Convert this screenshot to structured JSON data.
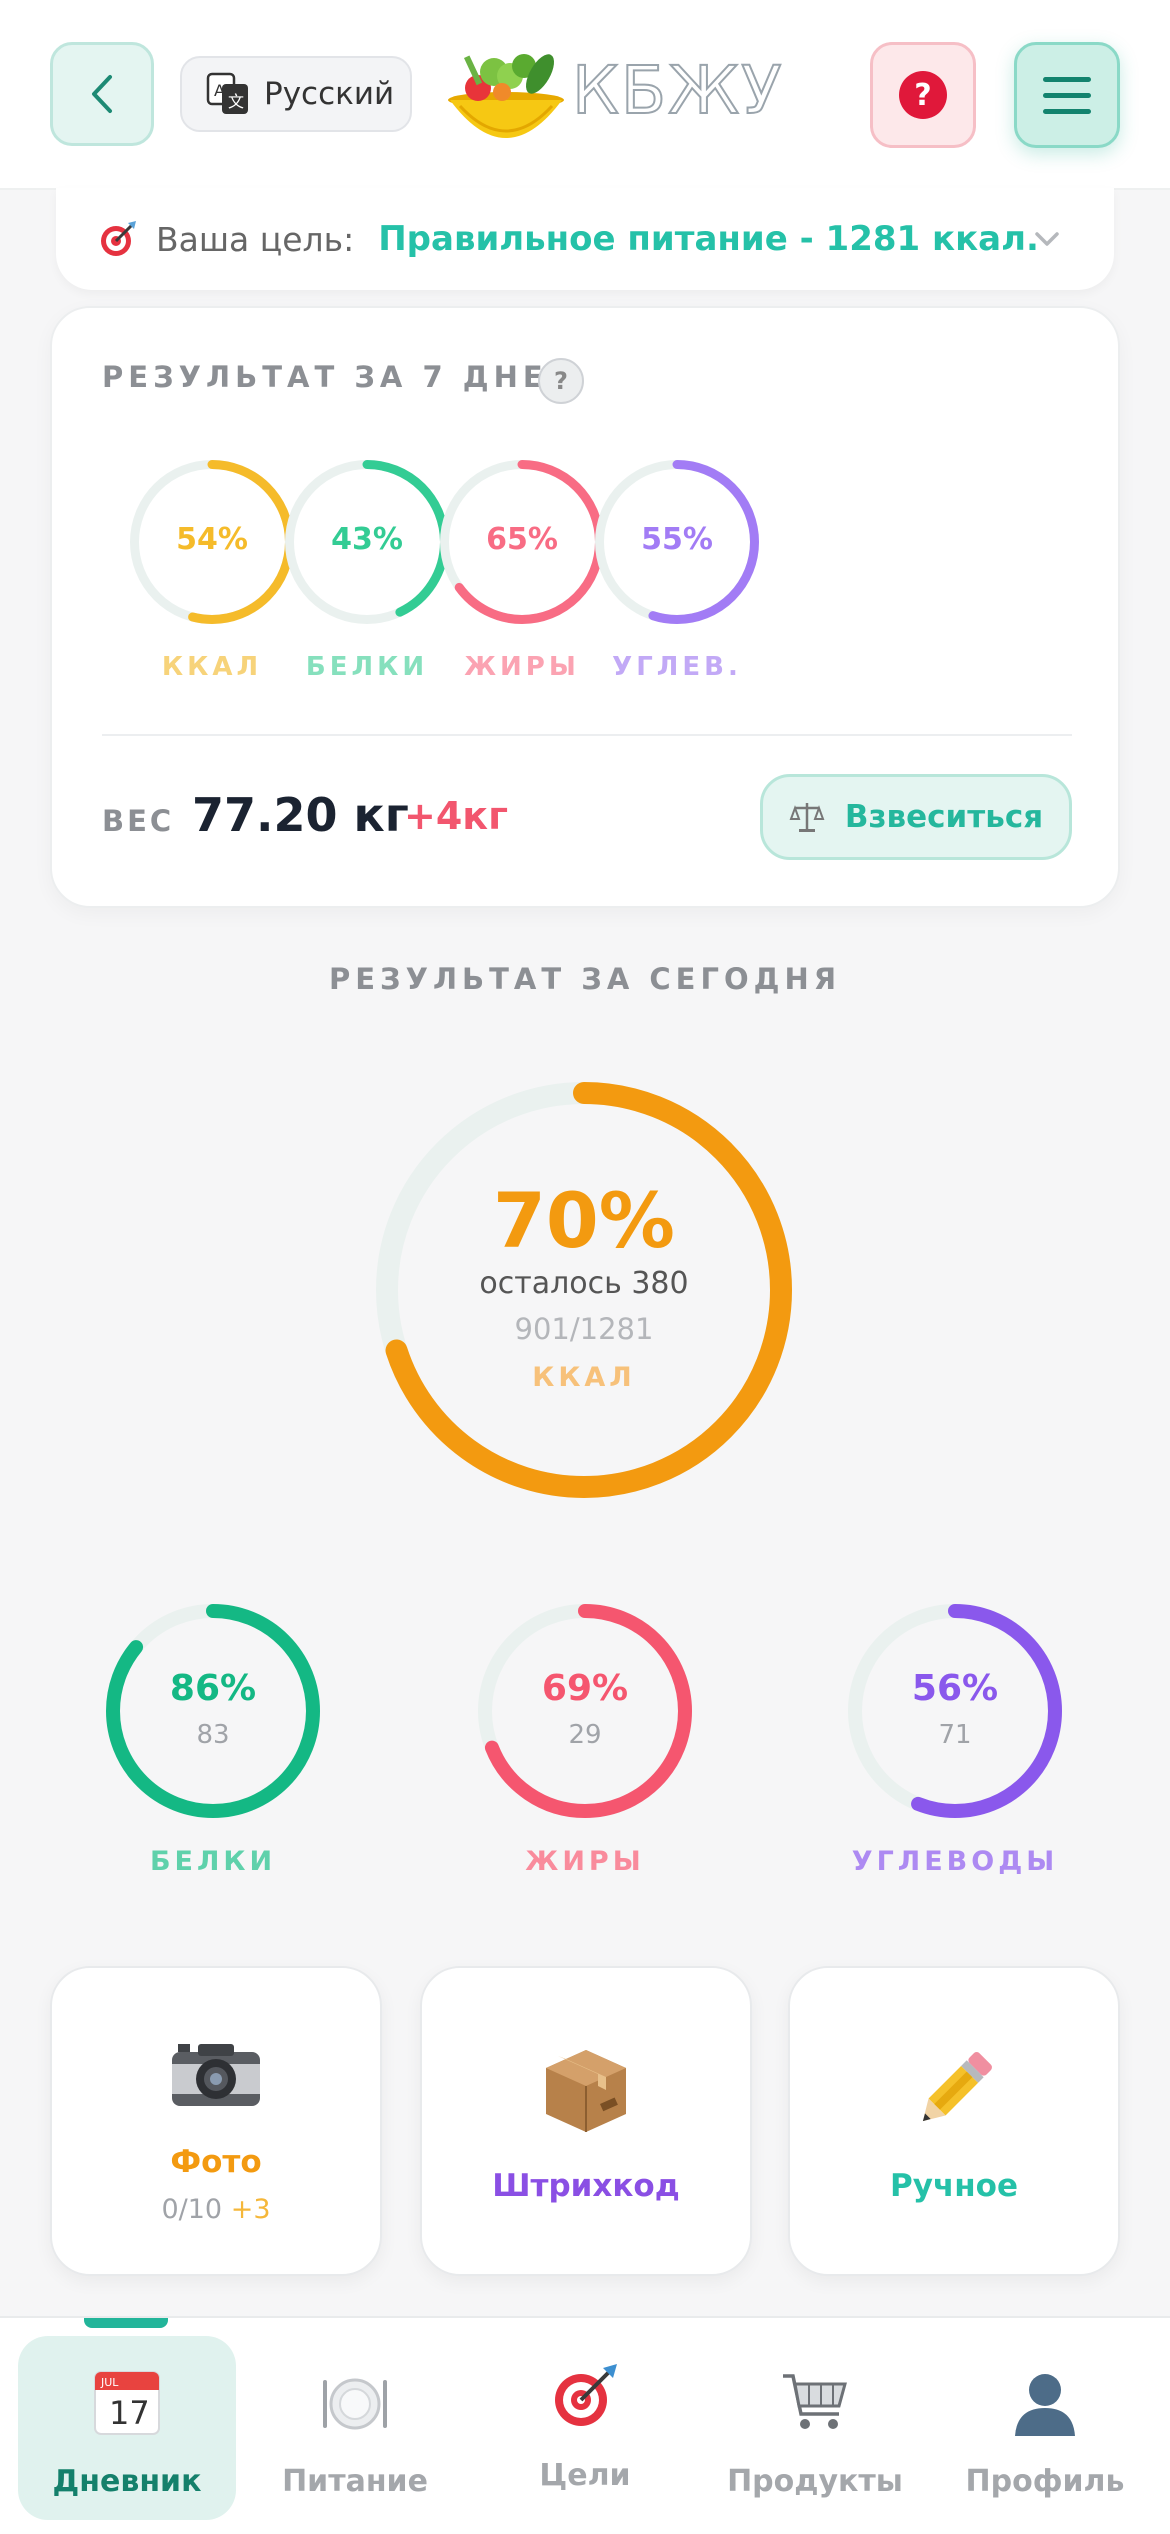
{
  "header": {
    "language": "Русский",
    "logo_text": "КБЖУ"
  },
  "goal": {
    "label": "Ваша цель:",
    "value": "Правильное питание - 1281 ккал."
  },
  "week": {
    "title": "РЕЗУЛЬТАТ ЗА 7 ДНЕЙ",
    "help": "?",
    "rings": [
      {
        "pct": "54%",
        "label": "ККАЛ",
        "value": 0.54,
        "color": "#f5bb2a",
        "label_color": "#f7d37a"
      },
      {
        "pct": "43%",
        "label": "БЕЛКИ",
        "value": 0.43,
        "color": "#33cc94",
        "label_color": "#86e0bd"
      },
      {
        "pct": "65%",
        "label": "ЖИРЫ",
        "value": 0.65,
        "color": "#f86c84",
        "label_color": "#fba3b2"
      },
      {
        "pct": "55%",
        "label": "УГЛЕВ.",
        "value": 0.55,
        "color": "#a27cf5",
        "label_color": "#c2a9f6"
      }
    ],
    "weight_label": "ВЕС",
    "weight_value": "77.20 кг",
    "weight_delta": "+4кг",
    "weigh_button": "Взвеситься"
  },
  "today": {
    "title": "РЕЗУЛЬТАТ ЗА СЕГОДНЯ",
    "kcal": {
      "pct": "70%",
      "value": 0.7,
      "remaining": "осталось 380",
      "ratio": "901/1281",
      "unit": "ККАЛ",
      "color": "#f39a10"
    },
    "macros": [
      {
        "pct": "86%",
        "num": "83",
        "label": "БЕЛКИ",
        "value": 0.86,
        "color": "#14b884",
        "label_color": "#5fd1ab"
      },
      {
        "pct": "69%",
        "num": "29",
        "label": "ЖИРЫ",
        "value": 0.69,
        "color": "#f5566f",
        "label_color": "#f98b9c"
      },
      {
        "pct": "56%",
        "num": "71",
        "label": "УГЛЕВОДЫ",
        "value": 0.56,
        "color": "#8a58ec",
        "label_color": "#ad8af2"
      }
    ]
  },
  "actions": [
    {
      "label": "Фото",
      "sub": "0/10",
      "sub_extra": "+3",
      "icon": "camera-icon",
      "color": "#f39a10"
    },
    {
      "label": "Штрихкод",
      "icon": "package-icon",
      "color": "#8a4fe4"
    },
    {
      "label": "Ручное",
      "icon": "pencil-icon",
      "color": "#25c1a8"
    }
  ],
  "tabs": [
    {
      "label": "Дневник",
      "icon": "calendar-icon",
      "active": true
    },
    {
      "label": "Питание",
      "icon": "plate-icon"
    },
    {
      "label": "Цели",
      "icon": "target-icon"
    },
    {
      "label": "Продукты",
      "icon": "cart-icon"
    },
    {
      "label": "Профиль",
      "icon": "profile-icon"
    }
  ]
}
